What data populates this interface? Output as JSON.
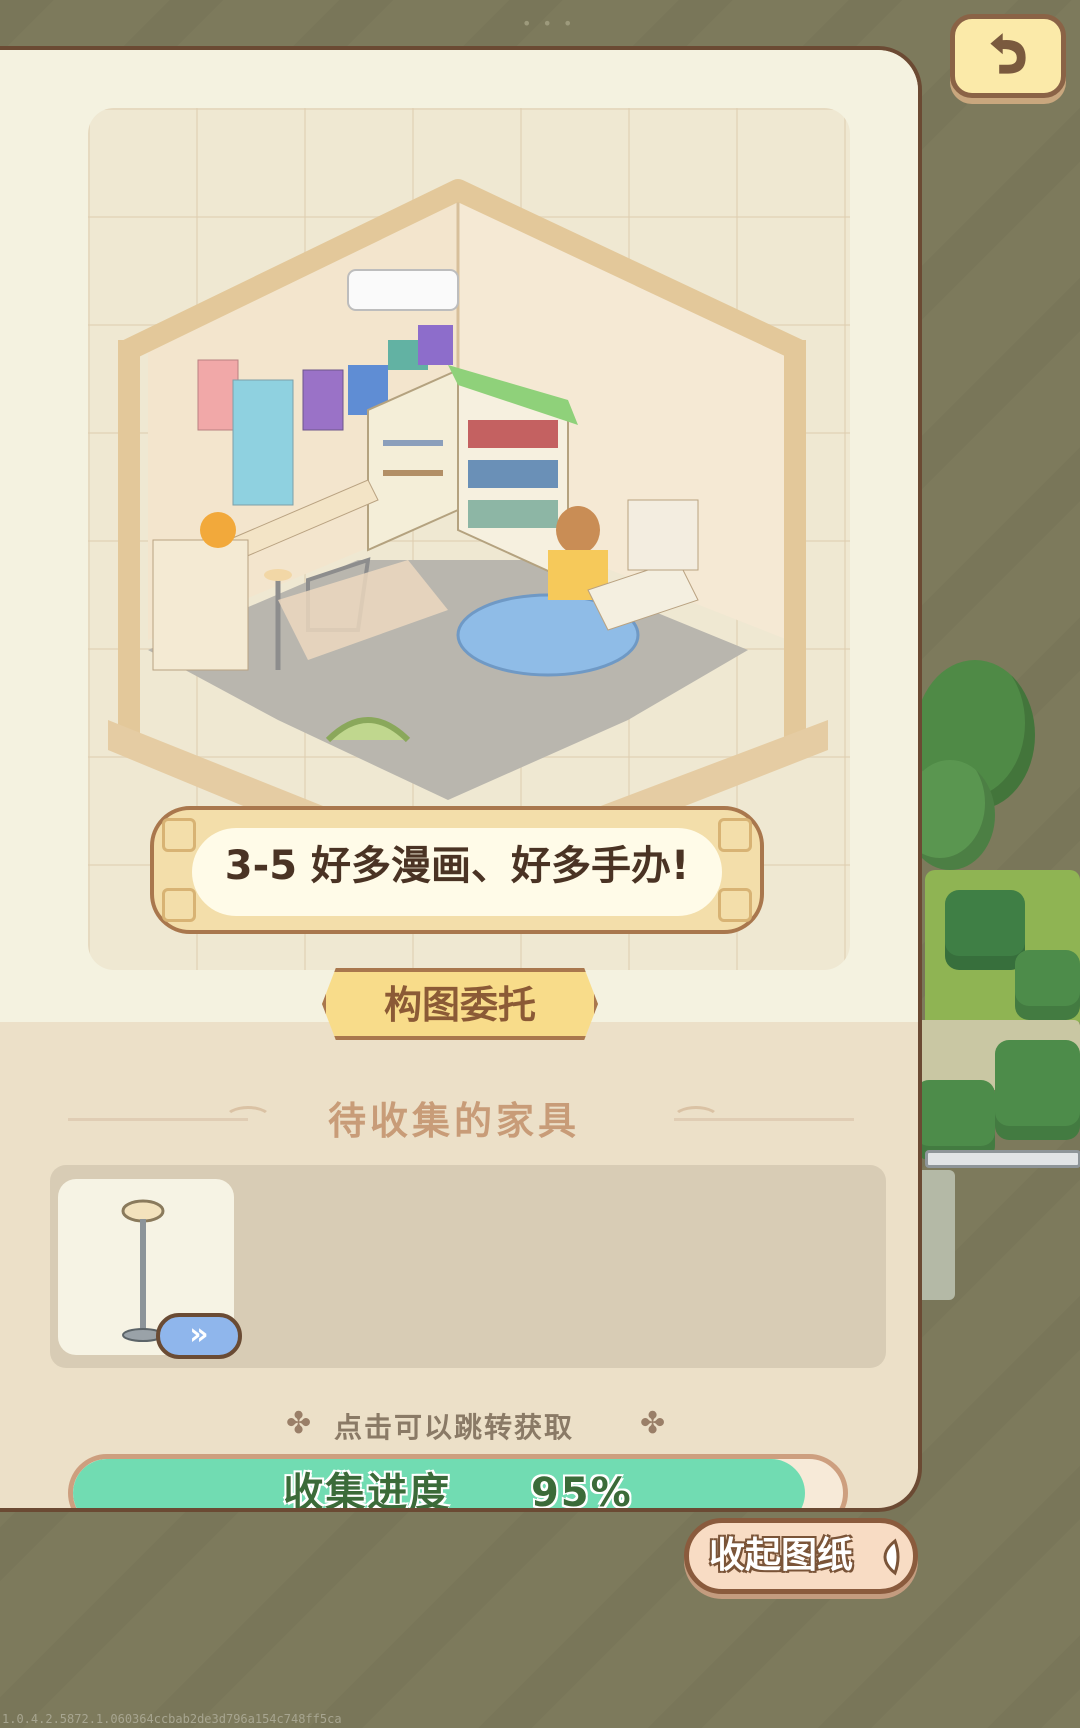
{
  "window": {
    "handle_dots": "• • •"
  },
  "level": {
    "title": "3-5 好多漫画、好多手办!",
    "tag": "构图委托"
  },
  "collection": {
    "section_title": "待收集的家具",
    "items": [
      {
        "name": "floor-lamp",
        "go_label": "»"
      }
    ],
    "hint": "点击可以跳转获取",
    "hint_ornament": "✤",
    "progress_label": "收集进度",
    "progress_value": "95%",
    "progress_fraction": 0.95
  },
  "buttons": {
    "back_icon": "undo-arrow",
    "collapse_label": "收起图纸"
  },
  "footer": {
    "version": "1.0.4.2.5872.1.060364ccbab2de3d796a154c748ff5ca"
  },
  "colors": {
    "accent_green": "#71dcb2",
    "frame_brown": "#6b4a33",
    "card_cream": "#f4f2e0"
  }
}
